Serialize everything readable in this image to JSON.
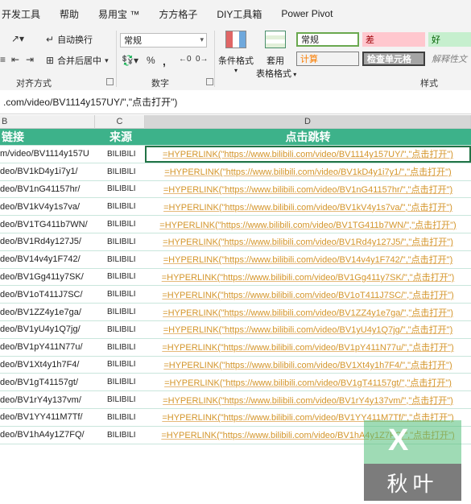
{
  "menu": {
    "tabs": [
      "开发工具",
      "帮助",
      "易用宝 ™",
      "方方格子",
      "DIY工具箱",
      "Power Pivot"
    ]
  },
  "ribbon": {
    "alignment": {
      "wrap_text": "自动换行",
      "merge_center": "合并后居中",
      "label": "对齐方式"
    },
    "number": {
      "format_value": "常规",
      "label": "数字"
    },
    "styles": {
      "conditional_formatting": "条件格式",
      "format_as_table_line1": "套用",
      "format_as_table_line2": "表格格式",
      "normal": "常规",
      "bad": "差",
      "good": "好",
      "calculation": "计算",
      "check_cell": "检查单元格",
      "explanatory": "解释性文",
      "label": "样式",
      "colors": {
        "normal_border": "#6aa84f",
        "bad_bg": "#ffc7ce",
        "bad_text": "#9c0006",
        "good_bg": "#c6efce",
        "good_text": "#006100",
        "calc_bg": "#f2f2f2",
        "calc_text": "#fa7d00",
        "check_bg": "#a5a5a5",
        "check_text": "#ffffff"
      }
    }
  },
  "formula_bar": {
    "text": ".com/video/BV1114y157UY/\",\"点击打开\")"
  },
  "columns": {
    "b": "B",
    "c": "C",
    "d": "D"
  },
  "table": {
    "header": {
      "link": "链接",
      "source": "来源",
      "click": "点击跳转"
    },
    "accent_color": "#3db28a",
    "link_color": "#d4952a",
    "rows": [
      {
        "link": "m/video/BV1114y157U",
        "source": "BILIBILI",
        "formula": "=HYPERLINK(\"https://www.bilibili.com/video/BV1114y157UY/\",\"点击打开\")"
      },
      {
        "link": "deo/BV1kD4y1i7y1/",
        "source": "BILIBILI",
        "formula": "=HYPERLINK(\"https://www.bilibili.com/video/BV1kD4y1i7y1/\",\"点击打开\")"
      },
      {
        "link": "deo/BV1nG41157hr/",
        "source": "BILIBILI",
        "formula": "=HYPERLINK(\"https://www.bilibili.com/video/BV1nG41157hr/\",\"点击打开\")"
      },
      {
        "link": "deo/BV1kV4y1s7va/",
        "source": "BILIBILI",
        "formula": "=HYPERLINK(\"https://www.bilibili.com/video/BV1kV4y1s7va/\",\"点击打开\")"
      },
      {
        "link": "deo/BV1TG411b7WN/",
        "source": "BILIBILI",
        "formula": "=HYPERLINK(\"https://www.bilibili.com/video/BV1TG411b7WN/\",\"点击打开\")"
      },
      {
        "link": "deo/BV1Rd4y127J5/",
        "source": "BILIBILI",
        "formula": "=HYPERLINK(\"https://www.bilibili.com/video/BV1Rd4y127J5/\",\"点击打开\")"
      },
      {
        "link": "deo/BV14v4y1F742/",
        "source": "BILIBILI",
        "formula": "=HYPERLINK(\"https://www.bilibili.com/video/BV14v4y1F742/\",\"点击打开\")"
      },
      {
        "link": "deo/BV1Gg411y7SK/",
        "source": "BILIBILI",
        "formula": "=HYPERLINK(\"https://www.bilibili.com/video/BV1Gg411y7SK/\",\"点击打开\")"
      },
      {
        "link": "deo/BV1oT411J7SC/",
        "source": "BILIBILI",
        "formula": "=HYPERLINK(\"https://www.bilibili.com/video/BV1oT411J7SC/\",\"点击打开\")"
      },
      {
        "link": "deo/BV1ZZ4y1e7ga/",
        "source": "BILIBILI",
        "formula": "=HYPERLINK(\"https://www.bilibili.com/video/BV1ZZ4y1e7ga/\",\"点击打开\")"
      },
      {
        "link": "deo/BV1yU4y1Q7jg/",
        "source": "BILIBILI",
        "formula": "=HYPERLINK(\"https://www.bilibili.com/video/BV1yU4y1Q7jg/\",\"点击打开\")"
      },
      {
        "link": "deo/BV1pY411N77u/",
        "source": "BILIBILI",
        "formula": "=HYPERLINK(\"https://www.bilibili.com/video/BV1pY411N77u/\",\"点击打开\")"
      },
      {
        "link": "deo/BV1Xt4y1h7F4/",
        "source": "BILIBILI",
        "formula": "=HYPERLINK(\"https://www.bilibili.com/video/BV1Xt4y1h7F4/\",\"点击打开\")"
      },
      {
        "link": "deo/BV1gT41157gt/",
        "source": "BILIBILI",
        "formula": "=HYPERLINK(\"https://www.bilibili.com/video/BV1gT41157gt/\",\"点击打开\")"
      },
      {
        "link": "deo/BV1rY4y137vm/",
        "source": "BILIBILI",
        "formula": "=HYPERLINK(\"https://www.bilibili.com/video/BV1rY4y137vm/\",\"点击打开\")"
      },
      {
        "link": "deo/BV1YY411M7Tf/",
        "source": "BILIBILI",
        "formula": "=HYPERLINK(\"https://www.bilibili.com/video/BV1YY411M7Tf/\",\"点击打开\")"
      },
      {
        "link": "deo/BV1hA4y1Z7FQ/",
        "source": "BILIBILI",
        "formula": "=HYPERLINK(\"https://www.bilibili.com/video/BV1hA4y1Z7FQ/\",\"点击打开\")"
      }
    ]
  },
  "watermark": {
    "x_letter": "X",
    "text": "秋叶"
  }
}
